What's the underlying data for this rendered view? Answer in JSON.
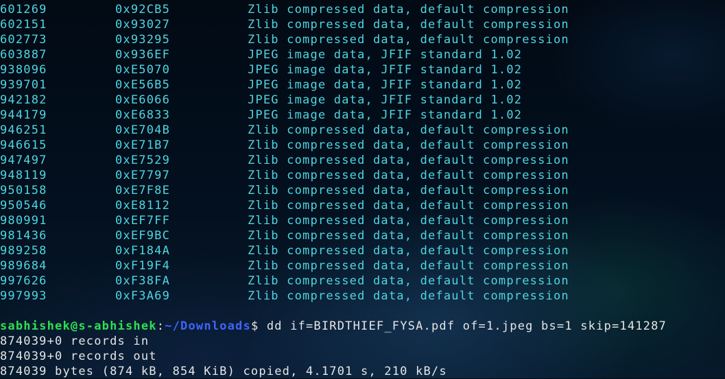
{
  "scan_rows": [
    {
      "decimal": "601269",
      "hex": "0x92CB5",
      "description": "Zlib compressed data, default compression"
    },
    {
      "decimal": "602151",
      "hex": "0x93027",
      "description": "Zlib compressed data, default compression"
    },
    {
      "decimal": "602773",
      "hex": "0x93295",
      "description": "Zlib compressed data, default compression"
    },
    {
      "decimal": "603887",
      "hex": "0x936EF",
      "description": "JPEG image data, JFIF standard 1.02"
    },
    {
      "decimal": "938096",
      "hex": "0xE5070",
      "description": "JPEG image data, JFIF standard 1.02"
    },
    {
      "decimal": "939701",
      "hex": "0xE56B5",
      "description": "JPEG image data, JFIF standard 1.02"
    },
    {
      "decimal": "942182",
      "hex": "0xE6066",
      "description": "JPEG image data, JFIF standard 1.02"
    },
    {
      "decimal": "944179",
      "hex": "0xE6833",
      "description": "JPEG image data, JFIF standard 1.02"
    },
    {
      "decimal": "946251",
      "hex": "0xE704B",
      "description": "Zlib compressed data, default compression"
    },
    {
      "decimal": "946615",
      "hex": "0xE71B7",
      "description": "Zlib compressed data, default compression"
    },
    {
      "decimal": "947497",
      "hex": "0xE7529",
      "description": "Zlib compressed data, default compression"
    },
    {
      "decimal": "948119",
      "hex": "0xE7797",
      "description": "Zlib compressed data, default compression"
    },
    {
      "decimal": "950158",
      "hex": "0xE7F8E",
      "description": "Zlib compressed data, default compression"
    },
    {
      "decimal": "950546",
      "hex": "0xE8112",
      "description": "Zlib compressed data, default compression"
    },
    {
      "decimal": "980991",
      "hex": "0xEF7FF",
      "description": "Zlib compressed data, default compression"
    },
    {
      "decimal": "981436",
      "hex": "0xEF9BC",
      "description": "Zlib compressed data, default compression"
    },
    {
      "decimal": "989258",
      "hex": "0xF184A",
      "description": "Zlib compressed data, default compression"
    },
    {
      "decimal": "989684",
      "hex": "0xF19F4",
      "description": "Zlib compressed data, default compression"
    },
    {
      "decimal": "997626",
      "hex": "0xF38FA",
      "description": "Zlib compressed data, default compression"
    },
    {
      "decimal": "997993",
      "hex": "0xF3A69",
      "description": "Zlib compressed data, default compression"
    }
  ],
  "prompt": {
    "user_host": "sabhishek@s-abhishek",
    "separator": ":",
    "path": "~/Downloads",
    "dollar": "$ ",
    "command": "dd if=BIRDTHIEF_FYSA.pdf of=1.jpeg bs=1 skip=141287"
  },
  "output_lines": [
    "874039+0 records in",
    "874039+0 records out",
    "874039 bytes (874 kB, 854 KiB) copied, 4.1701 s, 210 kB/s"
  ],
  "colors": {
    "scan_text": "#4fd6e0",
    "prompt_user": "#2ee052",
    "prompt_path": "#3f64ff",
    "default_text": "#e6e6e6"
  }
}
